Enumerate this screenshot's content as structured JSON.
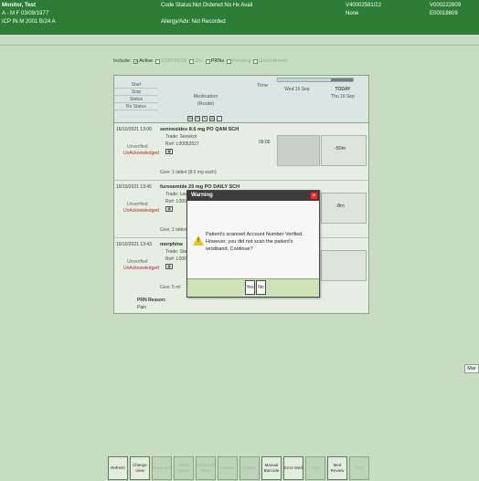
{
  "header": {
    "patient_name": "Monitor, Test",
    "line2": "A - M F 03/09/1977",
    "line3": "ICP IN M 2001 B/24 A",
    "code_status": "Code Status:Not Ordered No Hx Avail",
    "allergy": "Allergy/Adv: Not Recorded",
    "account1": "V40002581/22",
    "account2": "None",
    "mrn1": "V000222609",
    "mrn2": "E00018609"
  },
  "filters": {
    "label": "Include:",
    "items": [
      {
        "label": "Active",
        "checked": true,
        "dim": false
      },
      {
        "label": "STAT/NOW",
        "checked": false,
        "dim": true
      },
      {
        "label": "D/c",
        "checked": false,
        "dim": true
      },
      {
        "label": "PRNs",
        "checked": false,
        "dim": false
      },
      {
        "label": "Pending",
        "checked": false,
        "dim": true
      },
      {
        "label": "Unconfirmed",
        "checked": false,
        "dim": true
      }
    ]
  },
  "mar": {
    "left_labels": [
      "Start",
      "Stop",
      "Status",
      "Rx Status"
    ],
    "med_header": "Medication",
    "route_header": "(Route)",
    "time_header": "Time",
    "col1_header": "Wed 15 Sep",
    "col2_header_top": "TODAY",
    "col2_header_bottom": "Thu 16 Sep",
    "rows": [
      {
        "time": "16/10/2021 13:00",
        "status1": "Unverified",
        "status2": "UnAcknowledged",
        "med": "sennosides 8.6 mg PO QAM SCH",
        "trade": "Trade: Senokot",
        "rx": "Rx#: L00052527",
        "give": "Give: 1 tablet (8.6 mg each)",
        "cell_time": "09:00",
        "cell_mark": "-50m"
      },
      {
        "time": "16/10/2021 13:45",
        "status1": "Unverified",
        "status2": "UnAcknowledged",
        "med": "furosemide 20 mg PO DAILY SCH",
        "trade": "Trade: Lasix",
        "rx": "Rx#: L0000",
        "give": "Give: 1 tablet",
        "cell_time": "",
        "cell_mark": "-8m"
      },
      {
        "time": "16/10/2021 13:43",
        "status1": "Unverified",
        "status2": "UnAcknowledged",
        "med": "morphine",
        "trade": "Trade: Stat",
        "rx": "Rx#: L0000",
        "give": "Give: 5 ml",
        "cell_time": "",
        "cell_mark": ""
      }
    ],
    "prn_reason_label": "PRN Reason:",
    "prn_reason_value": "Pain"
  },
  "dialog": {
    "title": "Warning",
    "message": "Patient's scanned Account Number Verified. However, you did not scan the patient's wristband. Continue?",
    "yes_label": "Yes",
    "no_label": "No"
  },
  "side_tag": "Mar",
  "bottom_buttons": [
    {
      "label": "Refresh",
      "on": true
    },
    {
      "label": "Change View",
      "on": true
    },
    {
      "label": "Document",
      "on": false
    },
    {
      "label": "Admin Queue",
      "on": false
    },
    {
      "label": "Document Inbox",
      "on": false
    },
    {
      "label": "Interact",
      "on": false
    },
    {
      "label": "Notes",
      "on": false
    },
    {
      "label": "Manual Barcode",
      "on": true
    },
    {
      "label": "Error Med",
      "on": true
    },
    {
      "label": "Scan",
      "on": false
    },
    {
      "label": "Med Review",
      "on": true
    },
    {
      "label": "Exit",
      "on": false
    }
  ]
}
